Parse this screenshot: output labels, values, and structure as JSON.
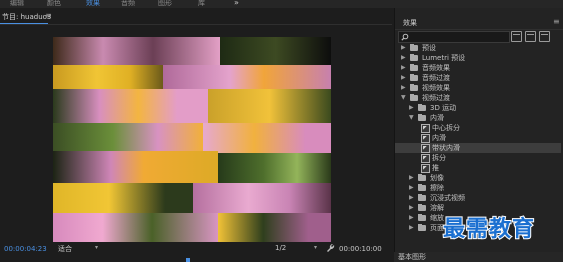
{
  "topbar": {
    "tabs": [
      {
        "label": "编辑",
        "active": false
      },
      {
        "label": "颜色",
        "active": false
      },
      {
        "label": "效果",
        "active": true
      },
      {
        "label": "音频",
        "active": false
      },
      {
        "label": "图形",
        "active": false
      },
      {
        "label": "库",
        "active": false
      }
    ],
    "more": "»"
  },
  "monitor": {
    "title": "节目: huaduo3",
    "menu": "≡",
    "timecode_current": "00:00:04:23",
    "fit": "适合",
    "resolution": "1/2",
    "timecode_duration": "00:00:10:00"
  },
  "effects": {
    "title": "效果",
    "menu": "≡",
    "search_placeholder": "",
    "items": [
      {
        "label": "预设",
        "type": "folder",
        "expanded": false,
        "depth": 0
      },
      {
        "label": "Lumetri 预设",
        "type": "folder",
        "expanded": false,
        "depth": 0
      },
      {
        "label": "音频效果",
        "type": "folder",
        "expanded": false,
        "depth": 0
      },
      {
        "label": "音频过渡",
        "type": "folder",
        "expanded": false,
        "depth": 0
      },
      {
        "label": "视频效果",
        "type": "folder",
        "expanded": false,
        "depth": 0
      },
      {
        "label": "视频过渡",
        "type": "folder",
        "expanded": true,
        "depth": 0
      },
      {
        "label": "3D 运动",
        "type": "folder",
        "expanded": false,
        "depth": 1
      },
      {
        "label": "内滑",
        "type": "folder",
        "expanded": true,
        "depth": 1
      },
      {
        "label": "中心拆分",
        "type": "effect",
        "depth": 2
      },
      {
        "label": "内滑",
        "type": "effect",
        "depth": 2
      },
      {
        "label": "带状内滑",
        "type": "effect",
        "depth": 2,
        "selected": true
      },
      {
        "label": "拆分",
        "type": "effect",
        "depth": 2
      },
      {
        "label": "推",
        "type": "effect",
        "depth": 2
      },
      {
        "label": "划像",
        "type": "folder",
        "expanded": false,
        "depth": 1
      },
      {
        "label": "擦除",
        "type": "folder",
        "expanded": false,
        "depth": 1
      },
      {
        "label": "沉浸式视频",
        "type": "folder",
        "expanded": false,
        "depth": 1
      },
      {
        "label": "溶解",
        "type": "folder",
        "expanded": false,
        "depth": 1
      },
      {
        "label": "缩放",
        "type": "folder",
        "expanded": false,
        "depth": 1
      },
      {
        "label": "页面剥落",
        "type": "folder",
        "expanded": false,
        "depth": 1
      }
    ],
    "bottom_label": "基本图形"
  },
  "watermark": "最需教育",
  "colors": {
    "accent": "#4a90e2",
    "panel": "#232323",
    "selected_row": "#3d3d3d",
    "watermark": "#1a6fd0"
  }
}
